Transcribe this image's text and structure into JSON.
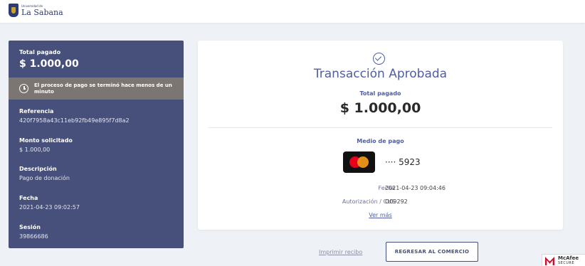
{
  "header": {
    "logo_small": "Universidad de",
    "logo_name": "La Sabana"
  },
  "sidebar": {
    "total_label": "Total pagado",
    "total_value": "$ 1.000,00",
    "notice": "El proceso de pago se terminó hace menos de un minuto",
    "referencia_label": "Referencia",
    "referencia_value": "420f7958a43c11eb92fb49e895f7d8a2",
    "monto_label": "Monto solicitado",
    "monto_value": "$ 1.000,00",
    "descripcion_label": "Descripción",
    "descripcion_value": "Pago de donación",
    "fecha_label": "Fecha",
    "fecha_value": "2021-04-23 09:02:57",
    "sesion_label": "Sesión",
    "sesion_value": "39866686"
  },
  "card": {
    "title": "Transacción Aprobada",
    "total_label": "Total pagado",
    "total_value": "$ 1.000,00",
    "medio_label": "Medio de pago",
    "masked_number": "···· 5923",
    "fecha_label": "Fecha",
    "fecha_value": "2021-04-23 09:04:46",
    "autorizacion_label": "Autorización / CUS",
    "autorizacion_value": "O09292",
    "ver_mas": "Ver más"
  },
  "footer": {
    "print_label": "Imprimir recibo",
    "return_label": "REGRESAR AL COMERCIO"
  },
  "badge": {
    "name": "McAfee",
    "secure": "SECURE"
  },
  "icons": {
    "clock": "clock-icon",
    "check": "check-circle-icon",
    "card_brand": "mastercard-icon"
  },
  "colors": {
    "sidebar_bg": "#46507a",
    "notice_bg": "#7c7672",
    "accent": "#4f5da3",
    "mastercard_red": "#eb001b",
    "mastercard_yellow": "#f79e1b"
  }
}
